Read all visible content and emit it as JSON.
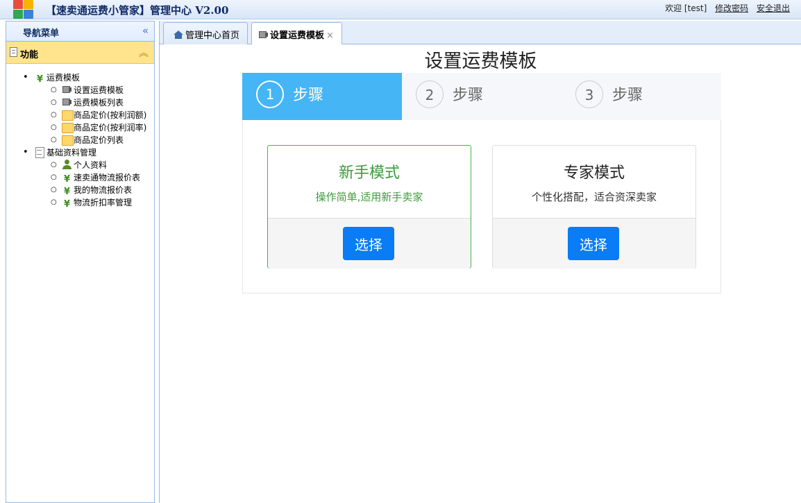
{
  "header": {
    "app_title": "【速卖通运费小管家】管理中心 V2.00",
    "welcome": "欢迎 [test]",
    "change_password": "修改密码",
    "logout": "安全退出",
    "logo_colors": [
      "#e84c3d",
      "#f4b400",
      "#2fa84f",
      "#3b82d6"
    ]
  },
  "nav": {
    "title": "导航菜单",
    "section_title": "功能",
    "groups": [
      {
        "label": "运费模板",
        "icon": "yen-icon",
        "items": [
          {
            "label": "设置运费模板",
            "icon": "truck-icon"
          },
          {
            "label": "运费模板列表",
            "icon": "truck-icon"
          },
          {
            "label": "商品定价(按利润额)",
            "icon": "folder-icon"
          },
          {
            "label": "商品定价(按利润率)",
            "icon": "folder-icon"
          },
          {
            "label": "商品定价列表",
            "icon": "folder-icon"
          }
        ]
      },
      {
        "label": "基础资料管理",
        "icon": "document-icon",
        "items": [
          {
            "label": "个人资料",
            "icon": "user-icon"
          },
          {
            "label": "速卖通物流报价表",
            "icon": "yen-icon"
          },
          {
            "label": "我的物流报价表",
            "icon": "yen-icon"
          },
          {
            "label": "物流折扣率管理",
            "icon": "yen-icon"
          }
        ]
      }
    ]
  },
  "tabs": [
    {
      "label": "管理中心首页",
      "active": false
    },
    {
      "label": "设置运费模板",
      "active": true,
      "close": "×"
    }
  ],
  "main": {
    "title": "设置运费模板",
    "steps": [
      {
        "num": "1",
        "label": "步骤",
        "active": true
      },
      {
        "num": "2",
        "label": "步骤",
        "active": false
      },
      {
        "num": "3",
        "label": "步骤",
        "active": false
      }
    ],
    "cards": [
      {
        "title": "新手模式",
        "desc": "操作简单,适用新手卖家",
        "button": "选择",
        "selected": true
      },
      {
        "title": "专家模式",
        "desc": "个性化搭配，适合资深卖家",
        "button": "选择",
        "selected": false
      }
    ]
  },
  "colors": {
    "step_active": "#45b5f5",
    "button": "#0a7cf5",
    "selected_card": "#3c9c3c",
    "section_header": "#ffe48d"
  }
}
